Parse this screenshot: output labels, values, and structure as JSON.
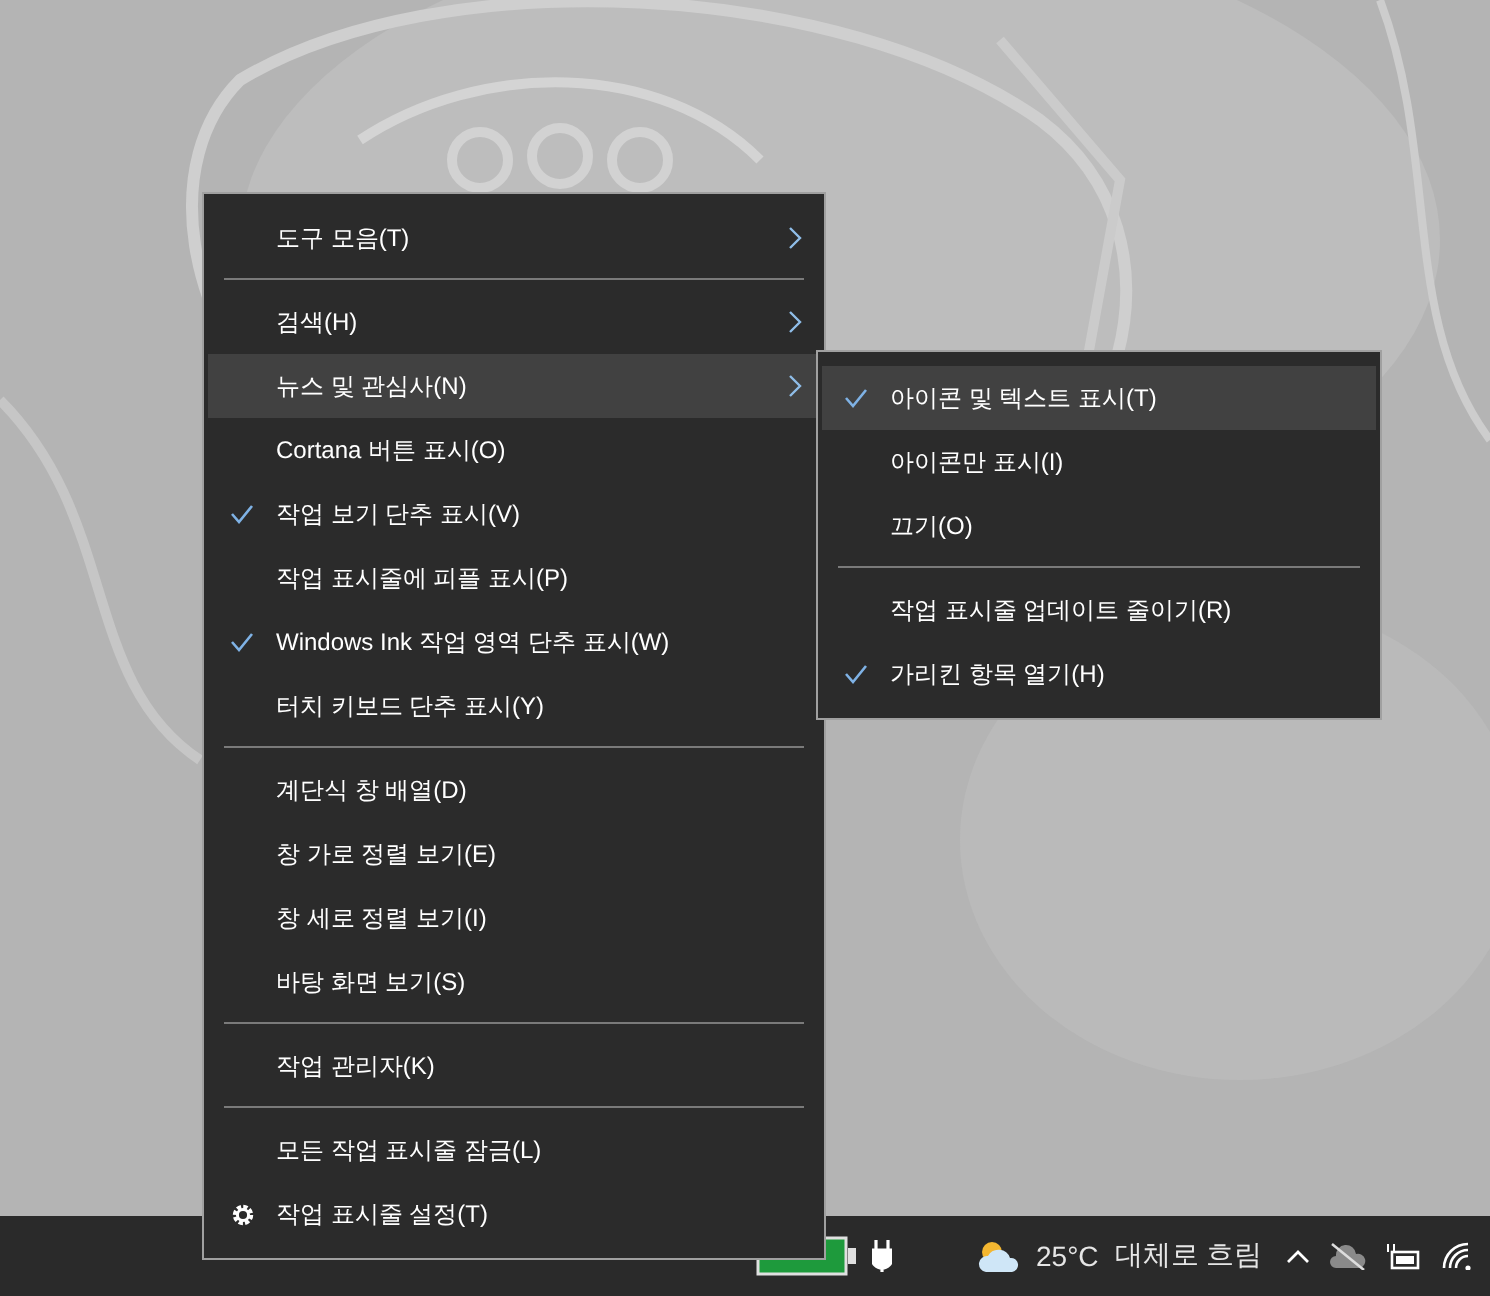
{
  "context_menu": {
    "items": [
      {
        "kind": "item",
        "label": "도구 모음(T)",
        "checked": false,
        "has_submenu": true,
        "selected": false
      },
      {
        "kind": "separator"
      },
      {
        "kind": "item",
        "label": "검색(H)",
        "checked": false,
        "has_submenu": true,
        "selected": false
      },
      {
        "kind": "item",
        "label": "뉴스 및 관심사(N)",
        "checked": false,
        "has_submenu": true,
        "selected": true
      },
      {
        "kind": "item",
        "label": "Cortana 버튼 표시(O)",
        "checked": false,
        "has_submenu": false,
        "selected": false
      },
      {
        "kind": "item",
        "label": "작업 보기 단추 표시(V)",
        "checked": true,
        "has_submenu": false,
        "selected": false
      },
      {
        "kind": "item",
        "label": "작업 표시줄에 피플 표시(P)",
        "checked": false,
        "has_submenu": false,
        "selected": false
      },
      {
        "kind": "item",
        "label": "Windows Ink 작업 영역 단추 표시(W)",
        "checked": true,
        "has_submenu": false,
        "selected": false
      },
      {
        "kind": "item",
        "label": "터치 키보드 단추 표시(Y)",
        "checked": false,
        "has_submenu": false,
        "selected": false
      },
      {
        "kind": "separator"
      },
      {
        "kind": "item",
        "label": "계단식 창 배열(D)",
        "checked": false,
        "has_submenu": false,
        "selected": false
      },
      {
        "kind": "item",
        "label": "창 가로 정렬 보기(E)",
        "checked": false,
        "has_submenu": false,
        "selected": false
      },
      {
        "kind": "item",
        "label": "창 세로 정렬 보기(I)",
        "checked": false,
        "has_submenu": false,
        "selected": false
      },
      {
        "kind": "item",
        "label": "바탕 화면 보기(S)",
        "checked": false,
        "has_submenu": false,
        "selected": false
      },
      {
        "kind": "separator"
      },
      {
        "kind": "item",
        "label": "작업 관리자(K)",
        "checked": false,
        "has_submenu": false,
        "selected": false
      },
      {
        "kind": "separator"
      },
      {
        "kind": "item",
        "label": "모든 작업 표시줄 잠금(L)",
        "checked": false,
        "has_submenu": false,
        "selected": false
      },
      {
        "kind": "settings",
        "label": "작업 표시줄 설정(T)",
        "selected": false
      }
    ]
  },
  "submenu": {
    "items": [
      {
        "kind": "item",
        "label": "아이콘 및 텍스트 표시(T)",
        "checked": true,
        "selected": true
      },
      {
        "kind": "item",
        "label": "아이콘만 표시(I)",
        "checked": false,
        "selected": false
      },
      {
        "kind": "item",
        "label": "끄기(O)",
        "checked": false,
        "selected": false
      },
      {
        "kind": "separator"
      },
      {
        "kind": "item",
        "label": "작업 표시줄 업데이트 줄이기(R)",
        "checked": false,
        "selected": false
      },
      {
        "kind": "item",
        "label": "가리킨 항목 열기(H)",
        "checked": true,
        "selected": false
      }
    ]
  },
  "taskbar": {
    "weather": {
      "temperature": "25°C",
      "condition": "대체로 흐림"
    }
  }
}
